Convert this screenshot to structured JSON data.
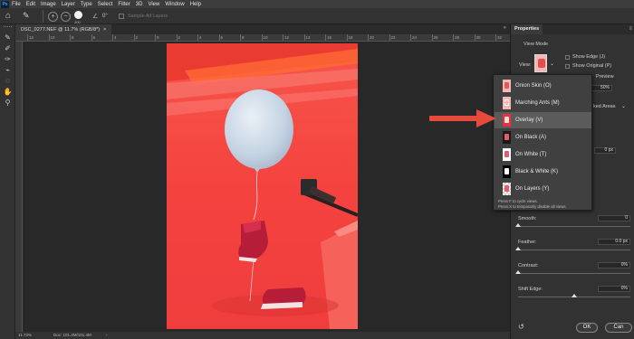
{
  "app": {
    "logo": "Ps",
    "menu": [
      "File",
      "Edit",
      "Image",
      "Layer",
      "Type",
      "Select",
      "Filter",
      "3D",
      "View",
      "Window",
      "Help"
    ]
  },
  "options_bar": {
    "brush_size": "200",
    "angle": "0°",
    "sample_all_layers": "Sample All Layers"
  },
  "document": {
    "tab_title": "DSC_0277.NEF @ 11.7% (RGB/8*)",
    "tab_close": "×"
  },
  "ruler": {
    "top_ticks": [
      "12",
      "10",
      "8",
      "6",
      "4",
      "2",
      "0",
      "2",
      "4",
      "6",
      "8",
      "10",
      "12",
      "14",
      "16",
      "18",
      "20",
      "22",
      "24",
      "26",
      "28",
      "30",
      "32"
    ]
  },
  "status": {
    "zoom": "11.73%",
    "doc": "Doc: 101.4M/101.4M"
  },
  "properties": {
    "tab": "Properties",
    "view_mode_label": "View Mode",
    "view_label": "View:",
    "show_edge": "Show Edge (J)",
    "show_original": "Show Original (P)",
    "preview_partial": "Preview",
    "opacity_value": "50%",
    "areas_partial": "ked Areas",
    "radius_value": "0 px",
    "smooth_label": "Smooth:",
    "smooth_value": "0",
    "feather_label": "Feather:",
    "feather_value": "0.0 px",
    "contrast_label": "Contrast:",
    "contrast_value": "0%",
    "shift_edge_label": "Shift Edge:",
    "shift_edge_value": "0%",
    "ok": "OK",
    "cancel": "Can",
    "slider_levels": {
      "smooth": 0,
      "feather": 0,
      "contrast": 0,
      "shift_edge": 0.5
    }
  },
  "view_menu": {
    "items": [
      {
        "label": "Onion Skin (O)",
        "thumb": "pink"
      },
      {
        "label": "Marching Ants (M)",
        "thumb": "pink"
      },
      {
        "label": "Overlay (V)",
        "thumb": "red"
      },
      {
        "label": "On Black (A)",
        "thumb": "dark"
      },
      {
        "label": "On White (T)",
        "thumb": "white"
      },
      {
        "label": "Black & White (K)",
        "thumb": "bw"
      },
      {
        "label": "On Layers (Y)",
        "thumb": "checker"
      }
    ],
    "selected_index": 2,
    "hint_1": "Press F to cycle views.",
    "hint_2": "Press X to temporarily disable all views."
  },
  "colors": {
    "accent_arrow": "#e64a3c",
    "photo_bg": "#f2403f"
  }
}
